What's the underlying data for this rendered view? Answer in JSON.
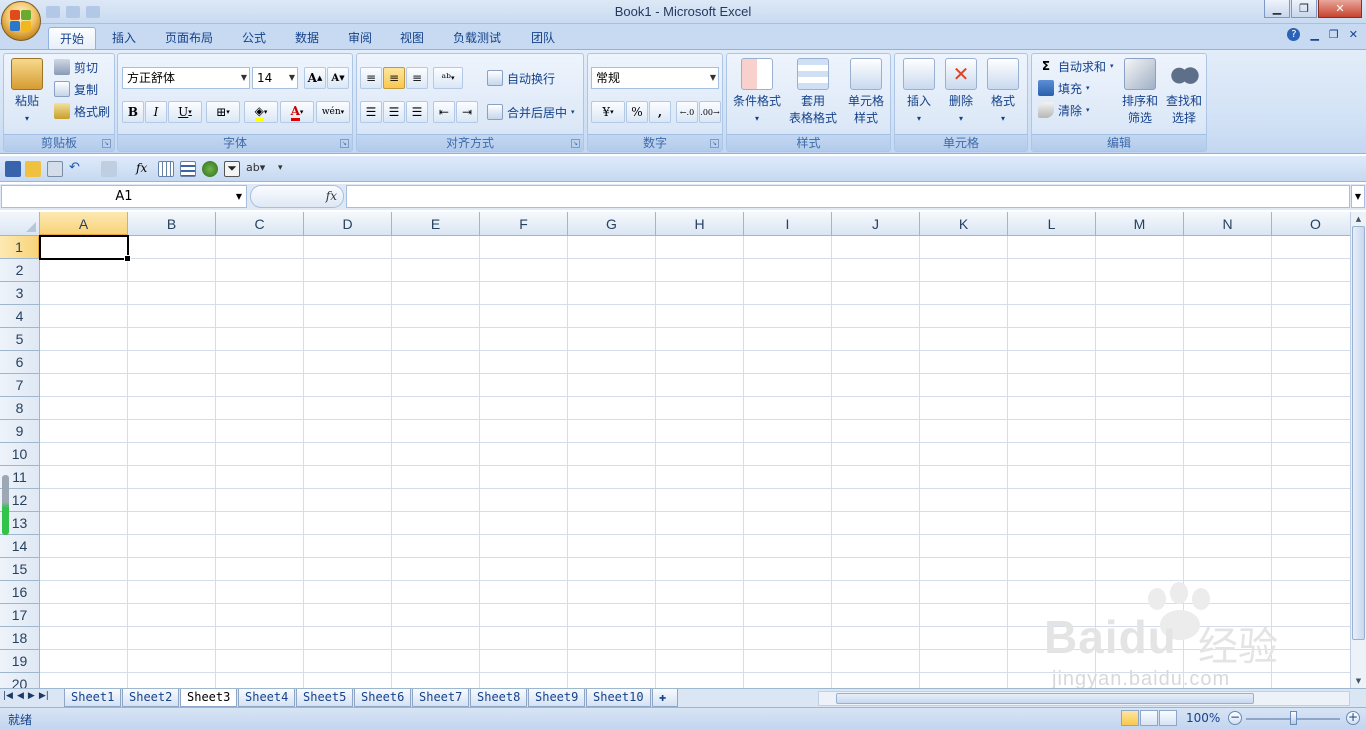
{
  "window": {
    "title": "Book1 - Microsoft Excel",
    "controls": [
      "minimize-icon",
      "restore-icon",
      "close-icon"
    ]
  },
  "tabs": [
    {
      "label": "开始",
      "active": true
    },
    {
      "label": "插入"
    },
    {
      "label": "页面布局"
    },
    {
      "label": "公式"
    },
    {
      "label": "数据"
    },
    {
      "label": "审阅"
    },
    {
      "label": "视图"
    },
    {
      "label": "负载测试"
    },
    {
      "label": "团队"
    }
  ],
  "ribbon": {
    "clipboard": {
      "group_label": "剪贴板",
      "paste": "粘贴",
      "cut": "剪切",
      "copy": "复制",
      "format_painter": "格式刷"
    },
    "font": {
      "group_label": "字体",
      "font_name": "方正舒体",
      "font_size": "14",
      "bold": "B",
      "italic": "I",
      "underline": "U",
      "grow": "A",
      "shrink": "A",
      "font_color_letter": "A",
      "phonetic": "wén"
    },
    "alignment": {
      "group_label": "对齐方式",
      "wrap_text": "自动换行",
      "merge_center": "合并后居中"
    },
    "number": {
      "group_label": "数字",
      "format": "常规",
      "percent": "%",
      "comma": ","
    },
    "styles": {
      "group_label": "样式",
      "conditional_1": "条件格式",
      "table_1": "套用",
      "table_2": "表格格式",
      "cell_1": "单元格",
      "cell_2": "样式"
    },
    "cells": {
      "group_label": "单元格",
      "insert": "插入",
      "delete": "删除",
      "format": "格式"
    },
    "editing": {
      "group_label": "编辑",
      "sigma": "Σ",
      "autosum": "自动求和",
      "fill": "填充",
      "clear": "清除",
      "sort_1": "排序和",
      "sort_2": "筛选",
      "find_1": "查找和",
      "find_2": "选择"
    }
  },
  "formula_bar": {
    "name_box": "A1",
    "fx": "fx",
    "formula": ""
  },
  "grid": {
    "columns": [
      "A",
      "B",
      "C",
      "D",
      "E",
      "F",
      "G",
      "H",
      "I",
      "J",
      "K",
      "L",
      "M",
      "N",
      "O"
    ],
    "rows": [
      "1",
      "2",
      "3",
      "4",
      "5",
      "6",
      "7",
      "8",
      "9",
      "10",
      "11",
      "12",
      "13",
      "14",
      "15",
      "16",
      "17",
      "18",
      "19",
      "20"
    ],
    "active_cell": "A1"
  },
  "sheets": [
    "Sheet1",
    "Sheet2",
    "Sheet3",
    "Sheet4",
    "Sheet5",
    "Sheet6",
    "Sheet7",
    "Sheet8",
    "Sheet9",
    "Sheet10"
  ],
  "active_sheet": "Sheet3",
  "status": {
    "text": "就绪",
    "zoom": "100%"
  },
  "watermark": {
    "brand": "Baidu",
    "brand_cn": "经验",
    "url": "jingyan.baidu.com"
  },
  "colors": {
    "ribbon_bg": "#dbe7f7",
    "accent": "#15428b",
    "selection": "#f8d37a"
  }
}
